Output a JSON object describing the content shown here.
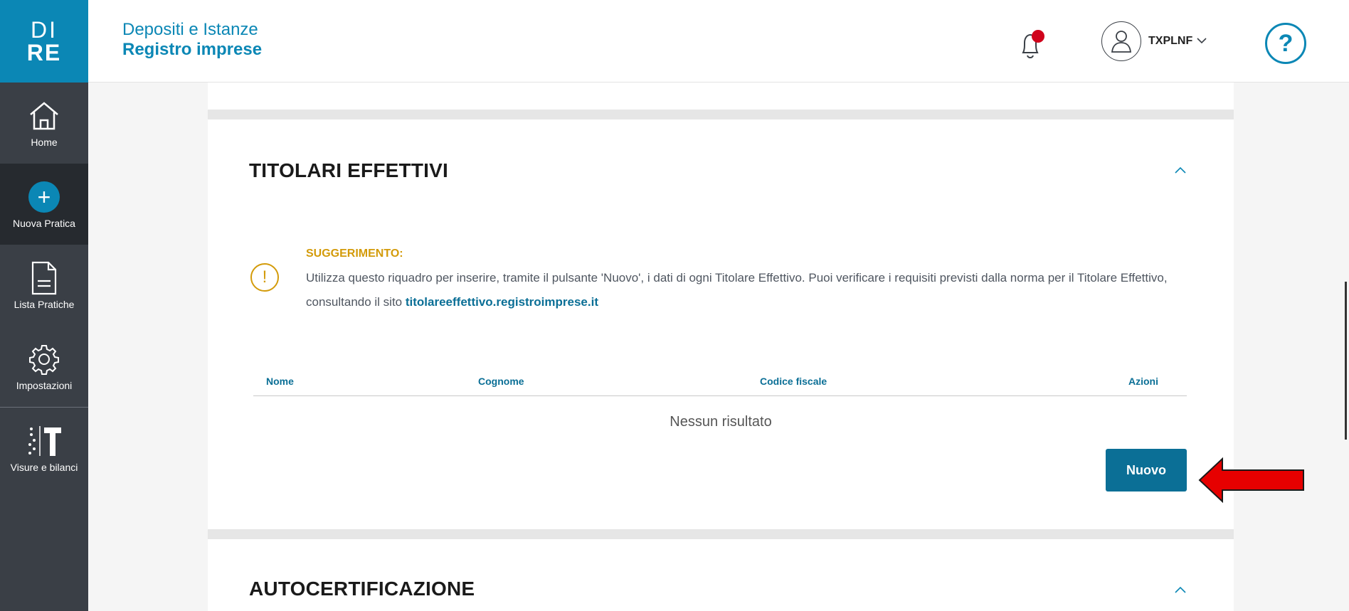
{
  "sidebar": {
    "logo_line1": "DI",
    "logo_line2": "RE",
    "items": [
      {
        "label": "Home",
        "icon": "home-icon"
      },
      {
        "label": "Nuova Pratica",
        "icon": "plus-icon"
      },
      {
        "label": "Lista Pratiche",
        "icon": "document-icon"
      },
      {
        "label": "Impostazioni",
        "icon": "gear-icon"
      },
      {
        "label": "Visure e bilanci",
        "icon": "visure-icon"
      }
    ]
  },
  "header": {
    "title_line1": "Depositi e Istanze",
    "title_line2": "Registro imprese",
    "user_name": "TXPLNF",
    "help_label": "?"
  },
  "section_titolari": {
    "title": "TITOLARI EFFETTIVI",
    "hint_label": "SUGGERIMENTO:",
    "hint_text": "Utilizza questo riquadro per inserire, tramite il pulsante 'Nuovo', i dati di ogni Titolare Effettivo. Puoi verificare i requisiti previsti dalla norma per il Titolare Effettivo, consultando il sito ",
    "hint_link": "titolareeffettivo.registroimprese.it",
    "columns": [
      "Nome",
      "Cognome",
      "Codice fiscale",
      "Azioni"
    ],
    "empty_text": "Nessun risultato",
    "new_button": "Nuovo"
  },
  "section_autocertificazione": {
    "title": "AUTOCERTIFICAZIONE"
  },
  "colors": {
    "brand": "#0b87b5",
    "button": "#0b6f96",
    "hint": "#d39b0a",
    "sidebar": "#3a3f46",
    "arrow": "#e60000"
  }
}
